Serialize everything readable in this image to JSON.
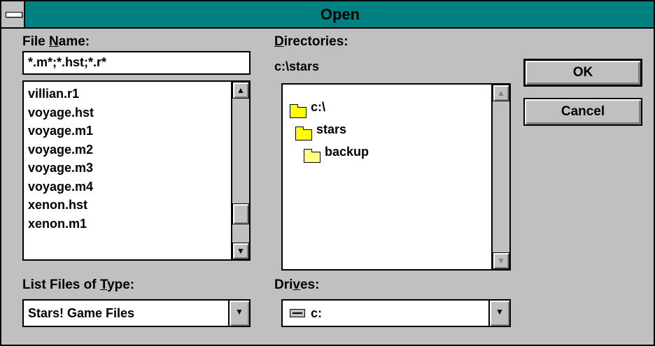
{
  "window": {
    "title": "Open"
  },
  "file_name": {
    "label_prefix": "File ",
    "label_mnemonic": "N",
    "label_suffix": "ame:",
    "value": "*.m*;*.hst;*.r*"
  },
  "files": {
    "items": [
      "villian.r1",
      "voyage.hst",
      "voyage.m1",
      "voyage.m2",
      "voyage.m3",
      "voyage.m4",
      "xenon.hst",
      "xenon.m1"
    ]
  },
  "directories": {
    "label_mnemonic": "D",
    "label_suffix": "irectories:",
    "current_path": "c:\\stars",
    "items": [
      {
        "name": "c:\\",
        "icon": "folder-open-icon"
      },
      {
        "name": "stars",
        "icon": "folder-open-icon"
      },
      {
        "name": "backup",
        "icon": "folder-closed-icon"
      }
    ]
  },
  "file_type": {
    "label_prefix": "List Files of ",
    "label_mnemonic": "T",
    "label_suffix": "ype:",
    "value": "Stars! Game Files"
  },
  "drives": {
    "label_prefix": "Dri",
    "label_mnemonic": "v",
    "label_suffix": "es:",
    "value": "c:",
    "icon": "drive-icon"
  },
  "buttons": {
    "ok": "OK",
    "cancel": "Cancel"
  },
  "colors": {
    "title_bar": "#008080",
    "face": "#c0c0c0",
    "window": "#ffffff"
  }
}
